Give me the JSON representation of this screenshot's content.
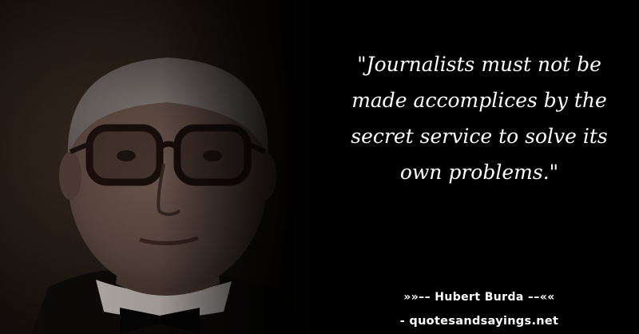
{
  "quote": {
    "text": "\"Journalists must not be made accomplices by the secret service to solve its own problems.\""
  },
  "author": {
    "line": "»»–– Hubert Burda ––««"
  },
  "source": {
    "line": "- quotesandsayings.net"
  },
  "photo": {
    "subject": "portrait-of-man-with-dark-rimmed-glasses"
  }
}
